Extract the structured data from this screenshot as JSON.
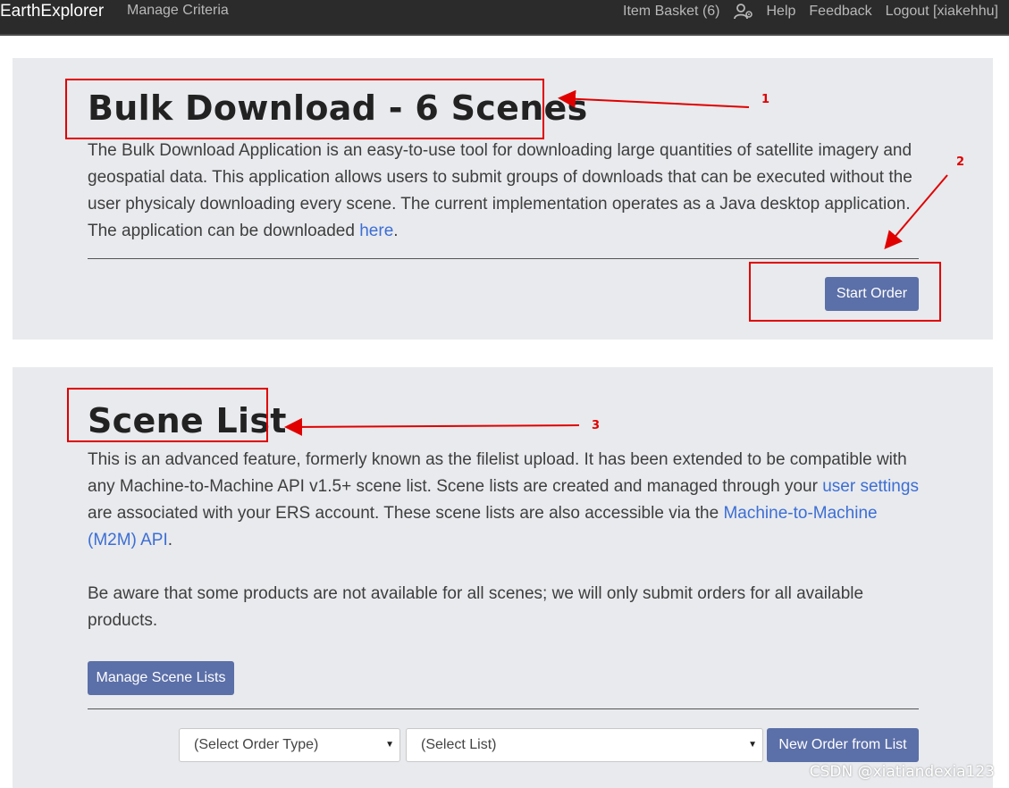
{
  "navbar": {
    "brand": "EarthExplorer",
    "manage_criteria": "Manage Criteria",
    "item_basket": "Item Basket (6)",
    "help": "Help",
    "feedback": "Feedback",
    "logout": "Logout [xiakehhu]"
  },
  "bulk": {
    "title": "Bulk Download - 6 Scenes",
    "text": "The Bulk Download Application is an easy-to-use tool for downloading large quantities of satellite imagery and geospatial data. This application allows users to submit groups of downloads that can be executed without the user physicaly downloading every scene. The current implementation operates as a Java desktop application. The application can be downloaded ",
    "link": "here",
    "text_end": ".",
    "start_order": "Start Order"
  },
  "scene_list": {
    "title": "Scene List",
    "text_a": "This is an advanced feature, formerly known as the filelist upload. It has been extended to be compatible with any Machine-to-Machine API v1.5+ scene list. Scene lists are created and managed through your ",
    "link_user_settings": "user settings",
    "text_b": " are associated with your ERS account. These scene lists are also accessible via the ",
    "link_m2m": "Machine-to-Machine (M2M) API",
    "text_c": ".",
    "note": "Be aware that some products are not available for all scenes; we will only submit orders for all available products.",
    "manage_button": "Manage Scene Lists",
    "order_type_select": "(Select Order Type)",
    "list_select": "(Select List)",
    "new_order_button": "New Order from List"
  },
  "annotations": {
    "n1": "1",
    "n2": "2",
    "n3": "3",
    "color": "#e00000"
  },
  "watermark": "CSDN @xiatiandexia123",
  "colors": {
    "navbar_bg": "#2b2b2b",
    "panel_bg": "#e8eaed",
    "button_bg": "#5b6fa8",
    "link": "#3d6ed4"
  }
}
